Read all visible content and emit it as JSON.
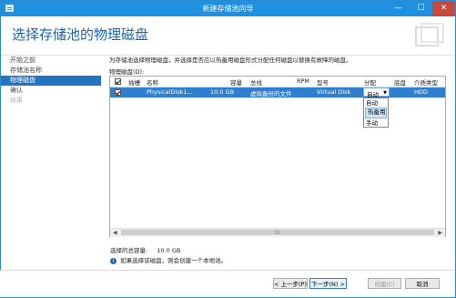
{
  "window": {
    "title": "新建存储池向导",
    "min": "—",
    "max": "☐",
    "close": "✕"
  },
  "header": {
    "title": "选择存储池的物理磁盘"
  },
  "sidebar": {
    "items": [
      {
        "label": "开始之前",
        "state": "normal"
      },
      {
        "label": "存储池名称",
        "state": "normal"
      },
      {
        "label": "物理磁盘",
        "state": "active"
      },
      {
        "label": "确认",
        "state": "normal"
      },
      {
        "label": "结果",
        "state": "disabled"
      }
    ]
  },
  "main": {
    "description": "为存储池选择物理磁盘，并选择是否应以热备用磁盘形式分配任何磁盘以替换有故障的磁盘。",
    "list_label": "物理磁盘(D):",
    "columns": [
      "插槽",
      "名称",
      "容量",
      "总线",
      "RPM",
      "型号",
      "分配",
      "底盘",
      "介质类型"
    ],
    "rows": [
      {
        "checked": true,
        "slot": "",
        "name": "PhysicalDisk1...",
        "capacity": "10.0 GB",
        "bus": "虚拟备份的文件",
        "rpm": "",
        "model": "Virtual Disk",
        "allocation": "自动",
        "chassis": "",
        "media": "HDD"
      }
    ],
    "dropdown_options": [
      "自动",
      "热备用",
      "手动"
    ],
    "hovered_option": "热备用",
    "total_label": "选择的总容量:",
    "total_value": "10.0 GB",
    "note": "如果选择该磁盘，则会创建一个本地池。",
    "info_glyph": "i",
    "scroll_left": "◀",
    "scroll_right": "▶",
    "scroll_grip": "|||",
    "dropdown_arrow": "▼"
  },
  "footer": {
    "prev": "< 上一步(P)",
    "next": "下一步(N) >",
    "create": "创建(C)",
    "cancel": "取消"
  },
  "colors": {
    "titlebar": "#1e91e0",
    "accent": "#2474c4",
    "selection": "#2f7fd0",
    "close": "#c64a3c"
  },
  "icons": {
    "app": "window-icon",
    "info": "info-icon"
  }
}
